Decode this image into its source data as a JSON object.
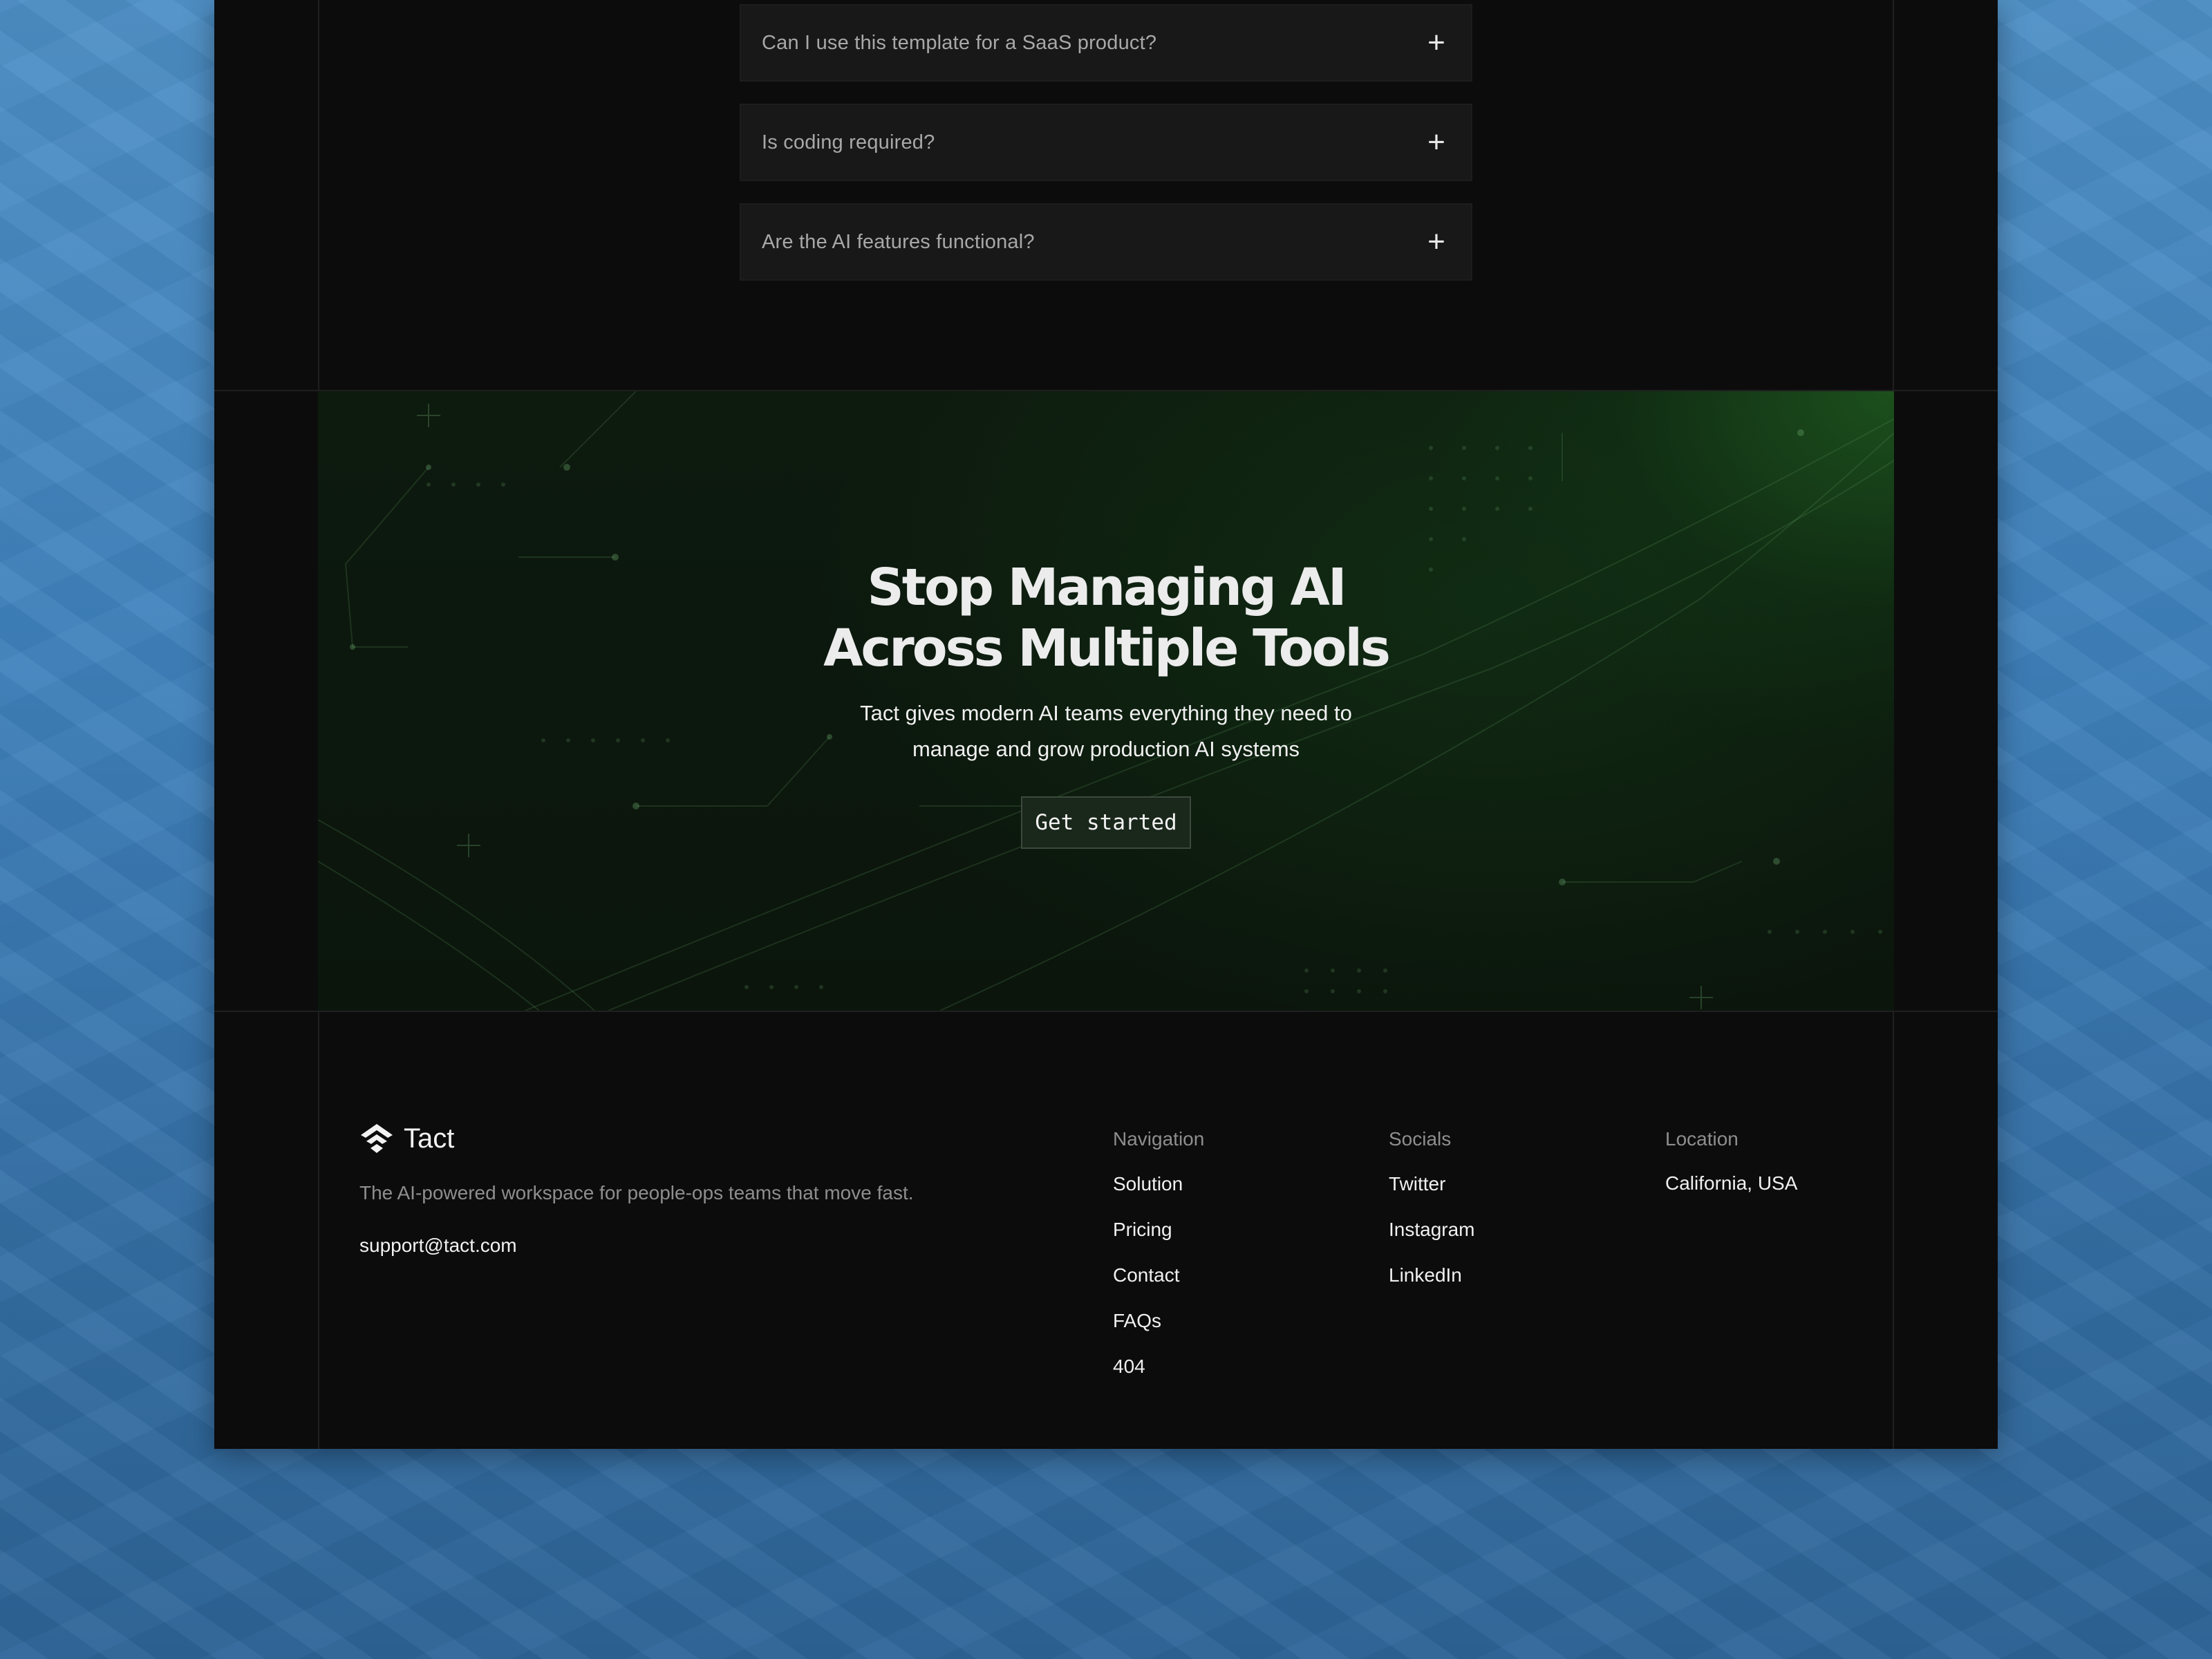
{
  "faq": {
    "items": [
      {
        "question": "Can I use this template for a SaaS product?"
      },
      {
        "question": "Is coding required?"
      },
      {
        "question": "Are the AI features functional?"
      }
    ],
    "expand_glyph": "+"
  },
  "cta": {
    "title_line1": "Stop Managing AI",
    "title_line2": "Across Multiple Tools",
    "subtitle_line1": "Tact gives modern AI teams everything they need to",
    "subtitle_line2": "manage and grow production AI systems",
    "button_label": "Get started"
  },
  "footer": {
    "brand_name": "Tact",
    "tagline": "The AI-powered workspace for people-ops teams that move fast.",
    "email": "support@tact.com",
    "navigation": {
      "heading": "Navigation",
      "links": [
        "Solution",
        "Pricing",
        "Contact",
        "FAQs",
        "404"
      ]
    },
    "socials": {
      "heading": "Socials",
      "links": [
        "Twitter",
        "Instagram",
        "LinkedIn"
      ]
    },
    "location": {
      "heading": "Location",
      "value": "California, USA"
    }
  },
  "colors": {
    "page_background": "#0c0c0c",
    "accent_green": "#2b7a2f",
    "backdrop_blue": "#3f82bd"
  },
  "icons": {
    "brand": "tact-logo-icon",
    "faq_toggle": "plus-icon"
  }
}
